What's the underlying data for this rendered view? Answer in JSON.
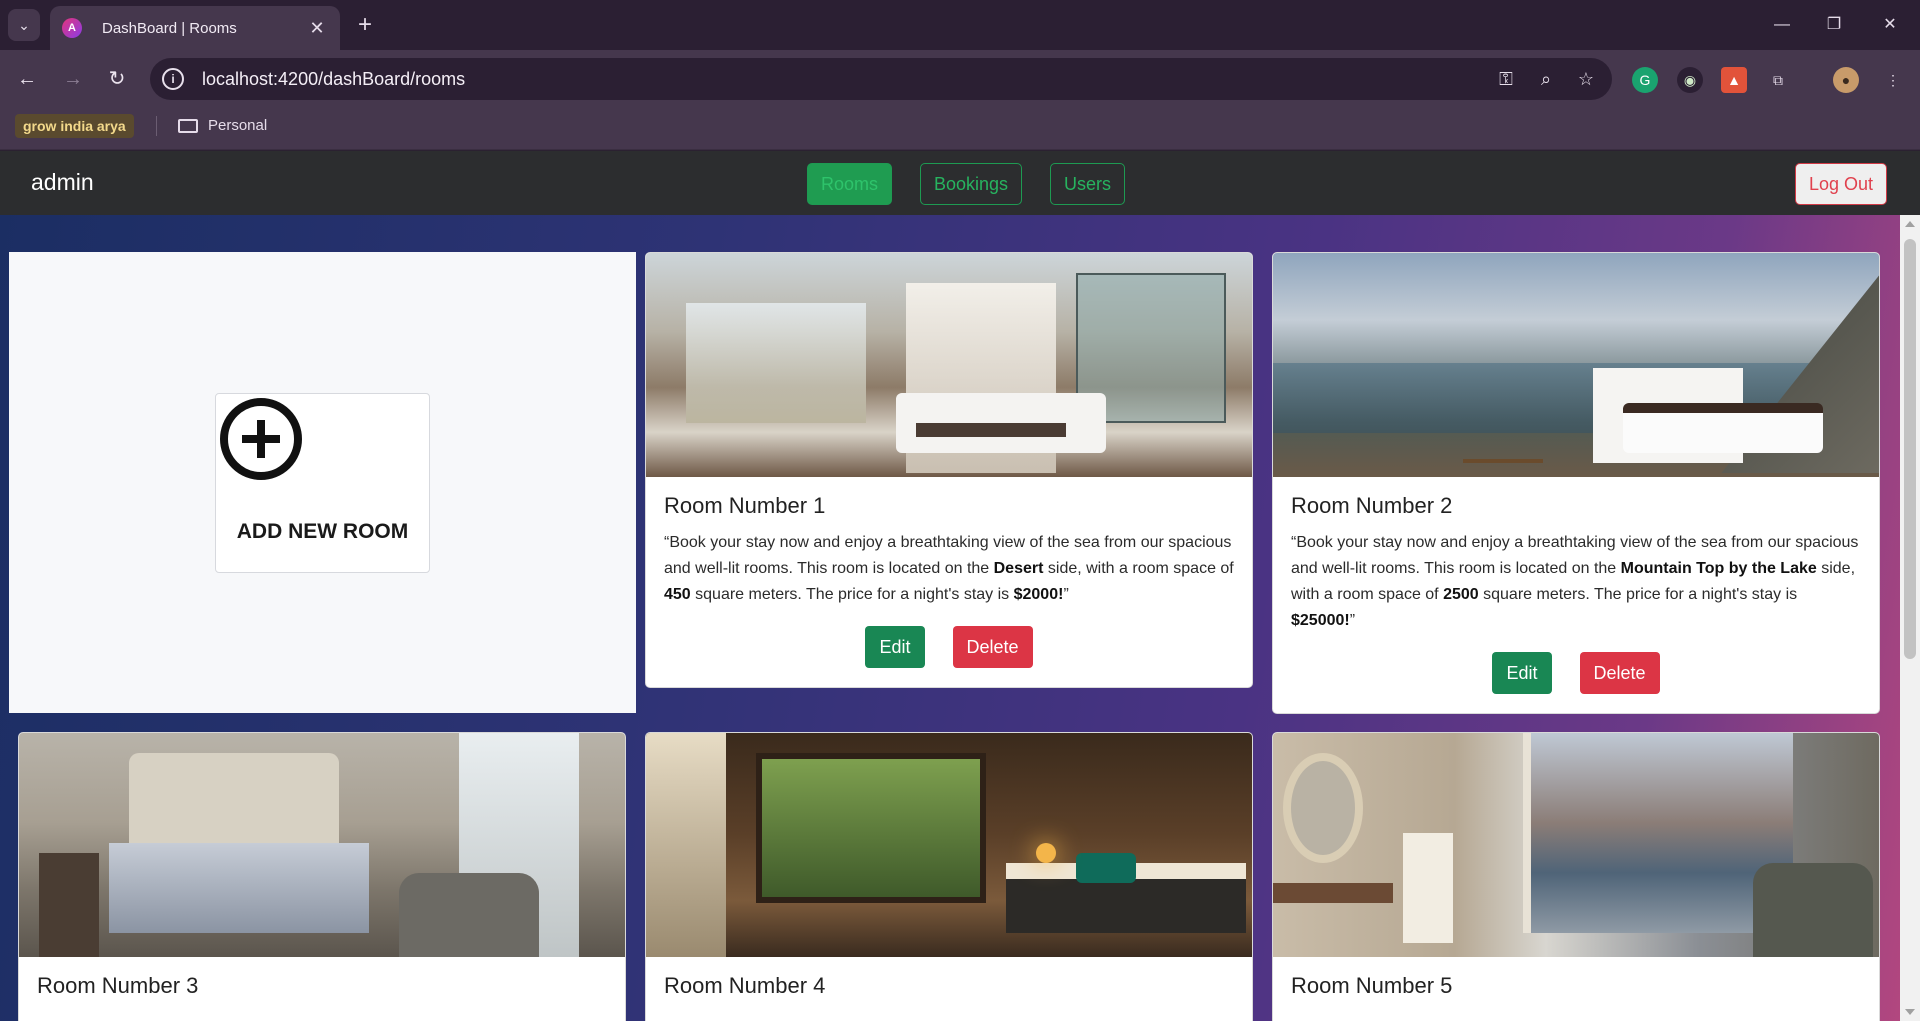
{
  "browser": {
    "tab_title": "DashBoard | Rooms",
    "url": "localhost:4200/dashBoard/rooms",
    "bookmark_chip": "grow india arya",
    "bookmark_folder": "Personal"
  },
  "navbar": {
    "brand": "admin",
    "links": [
      "Rooms",
      "Bookings",
      "Users"
    ],
    "active_link": "Rooms",
    "logout_label": "Log Out"
  },
  "add_room": {
    "label": "ADD NEW ROOM"
  },
  "buttons": {
    "edit": "Edit",
    "delete": "Delete"
  },
  "rooms": [
    {
      "title": "Room Number 1",
      "desc_1": "“Book your stay now and enjoy a breathtaking view of the sea from our spacious and well-lit rooms. This room is located on the ",
      "location": "Desert",
      "desc_2": " side, with a room space of ",
      "space": "450",
      "desc_3": " square meters. The price for a night's stay is ",
      "price": "$2000!",
      "desc_4": "”"
    },
    {
      "title": "Room Number 2",
      "desc_1": "“Book your stay now and enjoy a breathtaking view of the sea from our spacious and well-lit rooms. This room is located on the ",
      "location": "Mountain Top by the Lake",
      "desc_2": " side, with a room space of ",
      "space": "2500",
      "desc_3": " square meters. The price for a night's stay is ",
      "price": "$25000!",
      "desc_4": "”"
    },
    {
      "title": "Room Number 3"
    },
    {
      "title": "Room Number 4"
    },
    {
      "title": "Room Number 5"
    }
  ],
  "colors": {
    "nav_green": "#1f9c51",
    "logout_red": "#dc3545",
    "edit_green": "#198754",
    "delete_red": "#dc3545"
  }
}
